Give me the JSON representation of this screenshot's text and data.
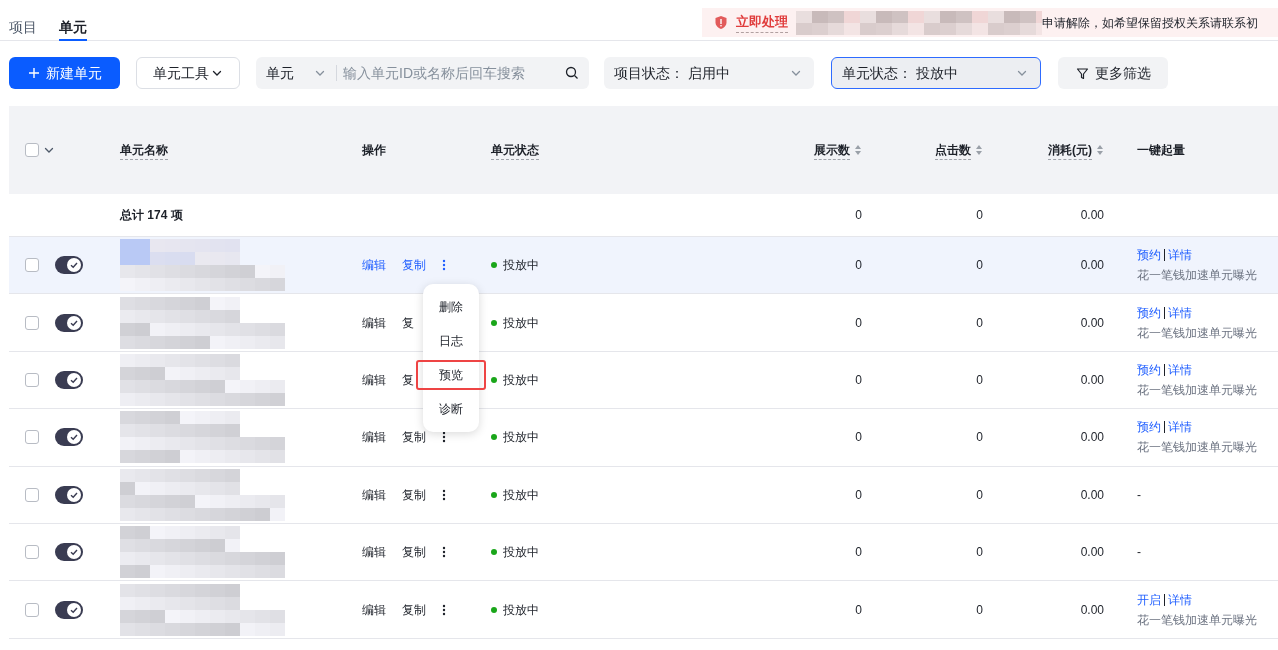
{
  "tabs": [
    {
      "label": "项目",
      "selected": false
    },
    {
      "label": "单元",
      "selected": true
    }
  ],
  "banner": {
    "action": "立即处理",
    "text": "申请解除，如希望保留授权关系请联系初"
  },
  "toolbar": {
    "create_button": "新建单元",
    "tools_button": "单元工具",
    "search": {
      "scope": "单元",
      "placeholder": "输入单元ID或名称后回车搜索"
    },
    "filters": [
      {
        "label": "项目状态：",
        "value": "启用中",
        "focused": false
      },
      {
        "label": "单元状态：",
        "value": "投放中",
        "focused": true
      }
    ],
    "more_filters": "更多筛选"
  },
  "table": {
    "select_all": {
      "checked": false
    },
    "columns": [
      {
        "label": "单元名称",
        "underlined": true,
        "sortable": false
      },
      {
        "label": "操作",
        "underlined": false,
        "sortable": false
      },
      {
        "label": "单元状态",
        "underlined": true,
        "sortable": false
      },
      {
        "label": "展示数",
        "underlined": true,
        "sortable": true
      },
      {
        "label": "点击数",
        "underlined": true,
        "sortable": true
      },
      {
        "label": "消耗(元)",
        "underlined": true,
        "sortable": true
      },
      {
        "label": "一键起量",
        "underlined": false,
        "sortable": false
      }
    ],
    "summary": {
      "label": "总计 174 项",
      "impressions": "0",
      "clicks": "0",
      "cost": "0.00"
    },
    "rows": [
      {
        "checked": false,
        "on": true,
        "hovered": true,
        "actions": [
          "编辑",
          "复制"
        ],
        "status": "投放中",
        "impressions": "0",
        "clicks": "0",
        "cost": "0.00",
        "boost": {
          "kind": "links",
          "links": [
            "预约",
            "详情"
          ],
          "note": "花一笔钱加速单元曝光"
        }
      },
      {
        "checked": false,
        "on": true,
        "hovered": false,
        "actions": [
          "编辑",
          "复"
        ],
        "status": "投放中",
        "impressions": "0",
        "clicks": "0",
        "cost": "0.00",
        "boost": {
          "kind": "links",
          "links": [
            "预约",
            "详情"
          ],
          "note": "花一笔钱加速单元曝光"
        }
      },
      {
        "checked": false,
        "on": true,
        "hovered": false,
        "actions": [
          "编辑",
          "复"
        ],
        "status": "投放中",
        "impressions": "0",
        "clicks": "0",
        "cost": "0.00",
        "boost": {
          "kind": "links",
          "links": [
            "预约",
            "详情"
          ],
          "note": "花一笔钱加速单元曝光"
        }
      },
      {
        "checked": false,
        "on": true,
        "hovered": false,
        "actions": [
          "编辑",
          "复制"
        ],
        "status": "投放中",
        "impressions": "0",
        "clicks": "0",
        "cost": "0.00",
        "boost": {
          "kind": "links",
          "links": [
            "预约",
            "详情"
          ],
          "note": "花一笔钱加速单元曝光"
        }
      },
      {
        "checked": false,
        "on": true,
        "hovered": false,
        "actions": [
          "编辑",
          "复制"
        ],
        "status": "投放中",
        "impressions": "0",
        "clicks": "0",
        "cost": "0.00",
        "boost": {
          "kind": "dash",
          "text": "-"
        }
      },
      {
        "checked": false,
        "on": true,
        "hovered": false,
        "actions": [
          "编辑",
          "复制"
        ],
        "status": "投放中",
        "impressions": "0",
        "clicks": "0",
        "cost": "0.00",
        "boost": {
          "kind": "dash",
          "text": "-"
        }
      },
      {
        "checked": false,
        "on": true,
        "hovered": false,
        "actions": [
          "编辑",
          "复制"
        ],
        "status": "投放中",
        "impressions": "0",
        "clicks": "0",
        "cost": "0.00",
        "boost": {
          "kind": "links",
          "links": [
            "开启",
            "详情"
          ],
          "note": "花一笔钱加速单元曝光"
        }
      }
    ]
  },
  "context_menu": {
    "items": [
      {
        "label": "删除",
        "highlighted": false
      },
      {
        "label": "日志",
        "highlighted": false
      },
      {
        "label": "预览",
        "highlighted": true
      },
      {
        "label": "诊断",
        "highlighted": false
      }
    ]
  }
}
